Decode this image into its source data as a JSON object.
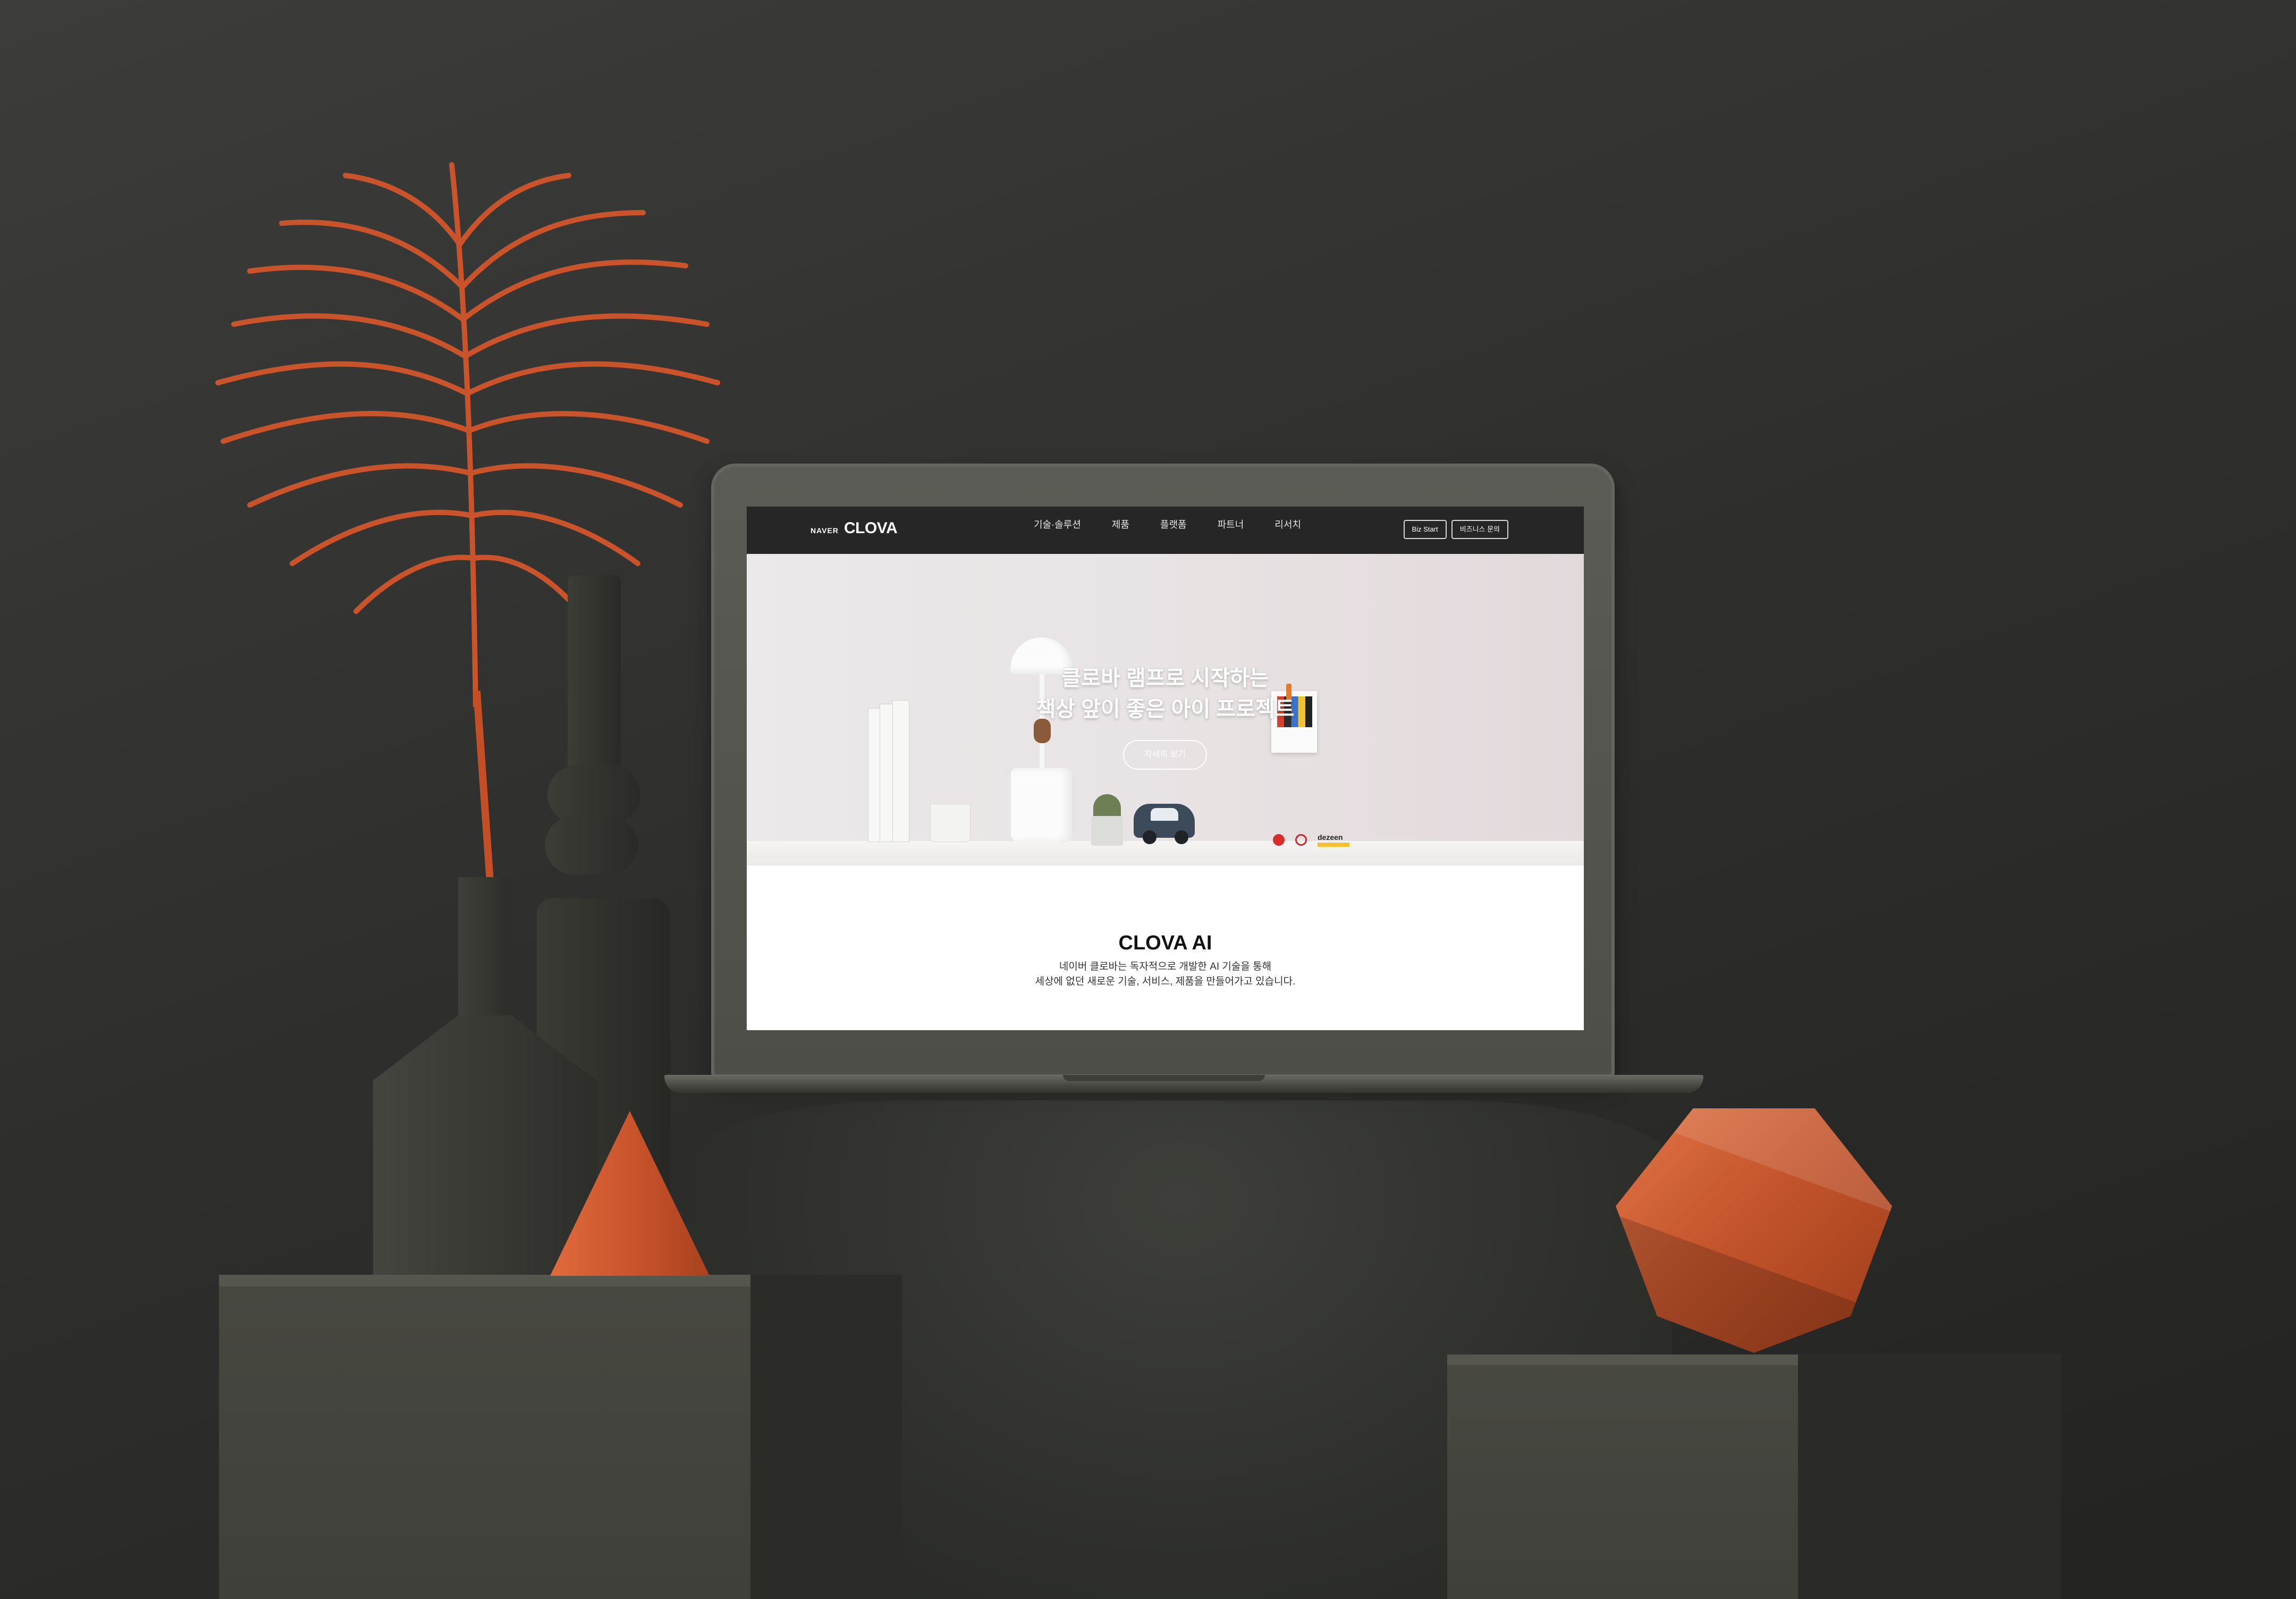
{
  "site": {
    "logo": {
      "naver": "NAVER",
      "clova": "CLOVA"
    },
    "nav": {
      "items": [
        {
          "label": "기술·솔루션"
        },
        {
          "label": "제품"
        },
        {
          "label": "플랫폼"
        },
        {
          "label": "파트너"
        },
        {
          "label": "리서치"
        }
      ],
      "buttons": {
        "biz_start": "Biz Start",
        "inquiry": "비즈니스 문의"
      }
    },
    "hero": {
      "title_line1": "클로바 램프로 시작하는",
      "title_line2": "책상 앞이 좋은 아이 프로젝트",
      "cta": "자세히 보기",
      "award_dezeen": "dezeen"
    },
    "intro": {
      "title": "CLOVA AI",
      "line1": "네이버 클로바는 독자적으로 개발한 AI 기술을 통해",
      "line2": "세상에 없던 새로운 기술, 서비스, 제품을 만들어가고 있습니다."
    }
  },
  "colors": {
    "nav_bg": "#262626",
    "accent_orange": "#c8532b",
    "scene_bg": "#333331",
    "laptop_body": "#54554f"
  }
}
